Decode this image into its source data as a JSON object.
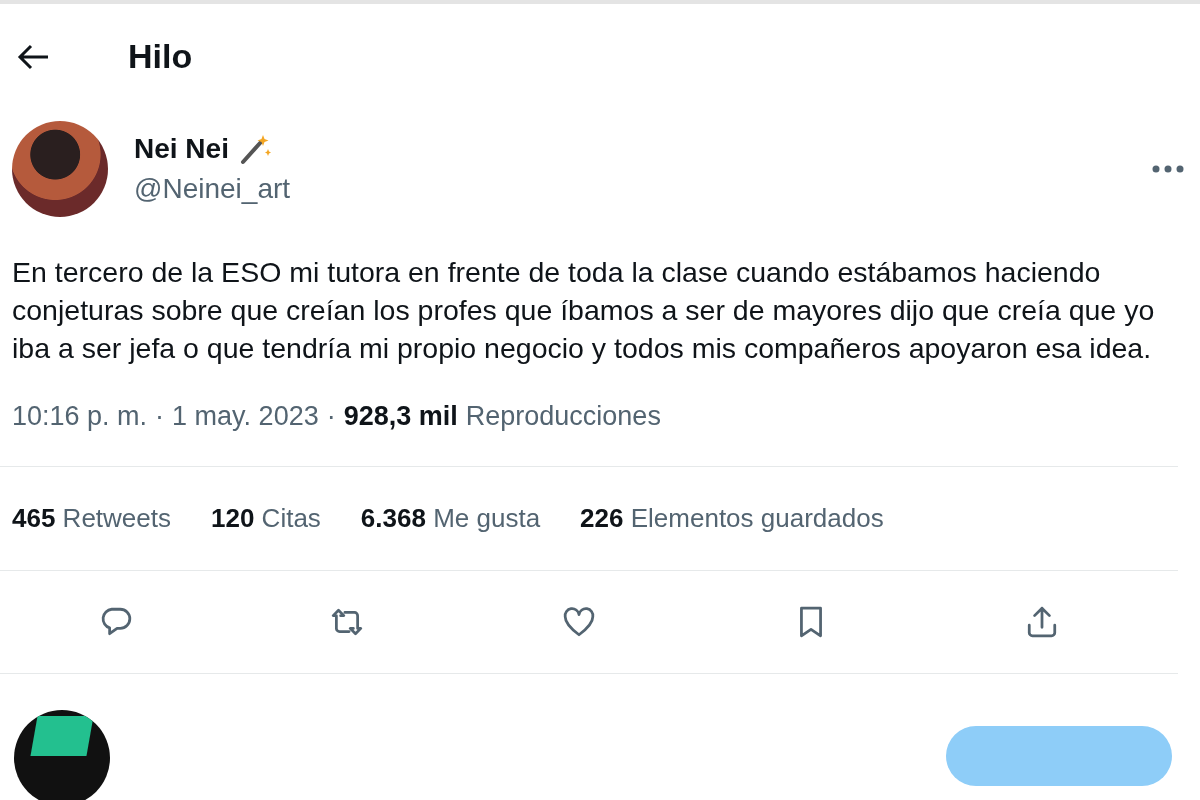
{
  "header": {
    "title": "Hilo"
  },
  "author": {
    "name": "Nei Nei",
    "handle": "@Neinei_art"
  },
  "text": "En tercero de la ESO mi tutora en frente de toda la clase cuando estábamos haciendo conjeturas sobre que creían los profes que íbamos a ser de mayores dijo que creía que yo iba a ser jefa o que tendría mi propio negocio y todos mis compañeros apoyaron esa idea.",
  "meta": {
    "separator": "·",
    "time": "10:16 p. m.",
    "date": "1 may. 2023",
    "views_count": "928,3 mil",
    "views_label": "Reproducciones"
  },
  "stats": [
    {
      "count": "465",
      "label": "Retweets"
    },
    {
      "count": "120",
      "label": "Citas"
    },
    {
      "count": "6.368",
      "label": "Me gusta"
    },
    {
      "count": "226",
      "label": "Elementos guardados"
    }
  ],
  "actions": [
    {
      "kind": "reply"
    },
    {
      "kind": "retweet"
    },
    {
      "kind": "like"
    },
    {
      "kind": "bookmark"
    },
    {
      "kind": "share"
    }
  ]
}
